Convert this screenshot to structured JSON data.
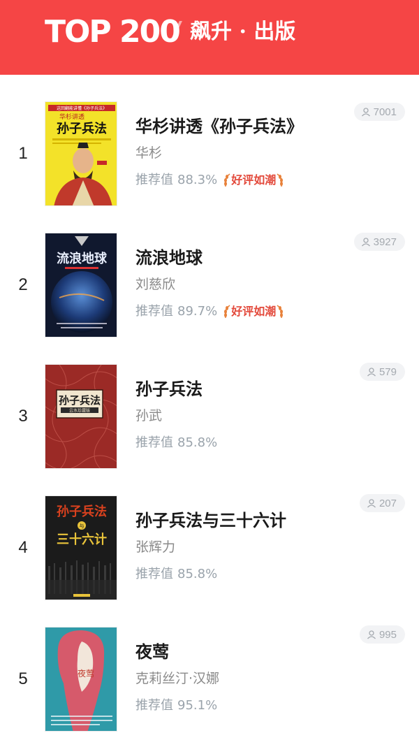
{
  "header": {
    "logo_text": "TOP 200",
    "subtitle": "飙升 · 出版",
    "background_color": "#f54545"
  },
  "books": [
    {
      "rank": "1",
      "title": "华杉讲透《孙子兵法》",
      "author": "华杉",
      "recommend_label": "推荐值",
      "recommend_value": "88.3%",
      "badge": "好评如潮",
      "readers": "7001",
      "cover": {
        "main": "孙子兵法",
        "top": "华杉讲透",
        "banner": "这回翻能讲懂《孙子兵法》",
        "bg": "#f3e229"
      }
    },
    {
      "rank": "2",
      "title": "流浪地球",
      "author": "刘慈欣",
      "recommend_label": "推荐值",
      "recommend_value": "89.7%",
      "badge": "好评如潮",
      "readers": "3927",
      "cover": {
        "main": "流浪地球",
        "bg": "#10182e"
      }
    },
    {
      "rank": "3",
      "title": "孙子兵法",
      "author": "孙武",
      "recommend_label": "推荐值",
      "recommend_value": "85.8%",
      "badge": "",
      "readers": "579",
      "cover": {
        "main": "孙子兵法",
        "sub": "云水珍藏版",
        "bg": "#9b2a26"
      }
    },
    {
      "rank": "4",
      "title": "孙子兵法与三十六计",
      "author": "张辉力",
      "recommend_label": "推荐值",
      "recommend_value": "85.8%",
      "badge": "",
      "readers": "207",
      "cover": {
        "line1": "孙子兵法",
        "joiner": "与",
        "line2": "三十六计",
        "bg": "#1b1b1b"
      }
    },
    {
      "rank": "5",
      "title": "夜莺",
      "author": "克莉丝汀·汉娜",
      "recommend_label": "推荐值",
      "recommend_value": "95.1%",
      "badge": "",
      "readers": "995",
      "cover": {
        "main": "夜莺",
        "bg": "#2f9aa8"
      }
    }
  ]
}
